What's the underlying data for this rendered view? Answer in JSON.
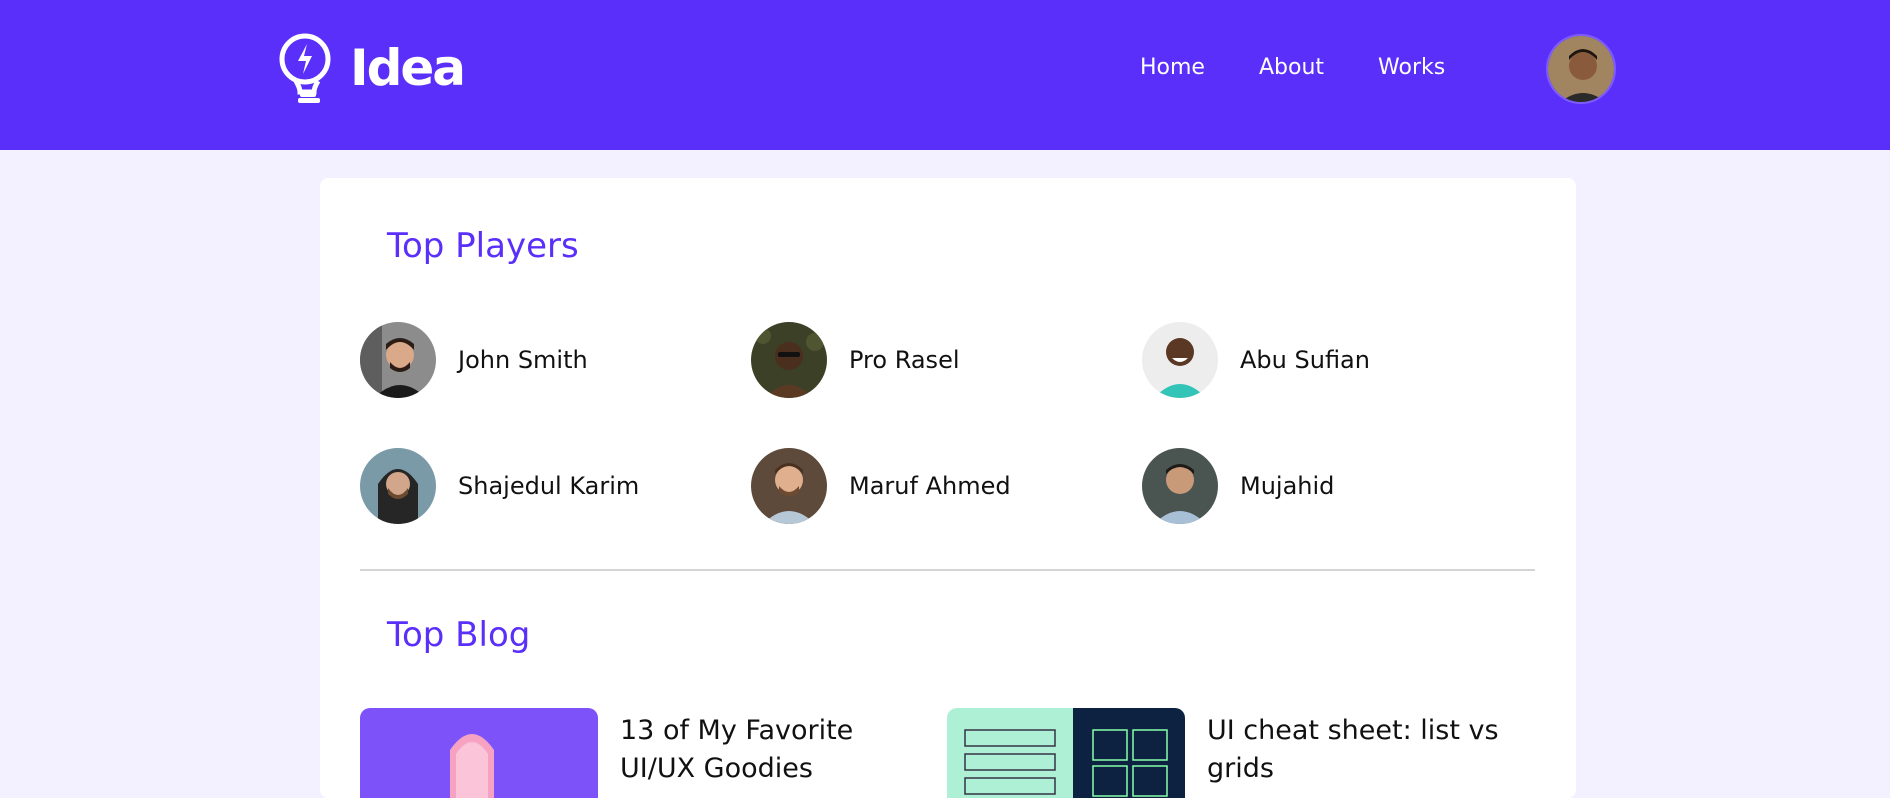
{
  "brand": {
    "name": "Idea"
  },
  "nav": {
    "items": [
      {
        "label": "Home"
      },
      {
        "label": "About"
      },
      {
        "label": "Works"
      }
    ]
  },
  "top_players": {
    "title": "Top Players",
    "players": [
      {
        "name": "John Smith"
      },
      {
        "name": "Pro Rasel"
      },
      {
        "name": "Abu Sufian"
      },
      {
        "name": "Shajedul Karim"
      },
      {
        "name": "Maruf Ahmed"
      },
      {
        "name": "Mujahid"
      }
    ]
  },
  "top_blog": {
    "title": "Top Blog",
    "posts": [
      {
        "title": "13 of My Favorite UI/UX Goodies"
      },
      {
        "title": "UI cheat sheet: list vs grids"
      }
    ]
  },
  "colors": {
    "brand": "#5a2ff9",
    "page_bg": "#f3f0ff"
  }
}
